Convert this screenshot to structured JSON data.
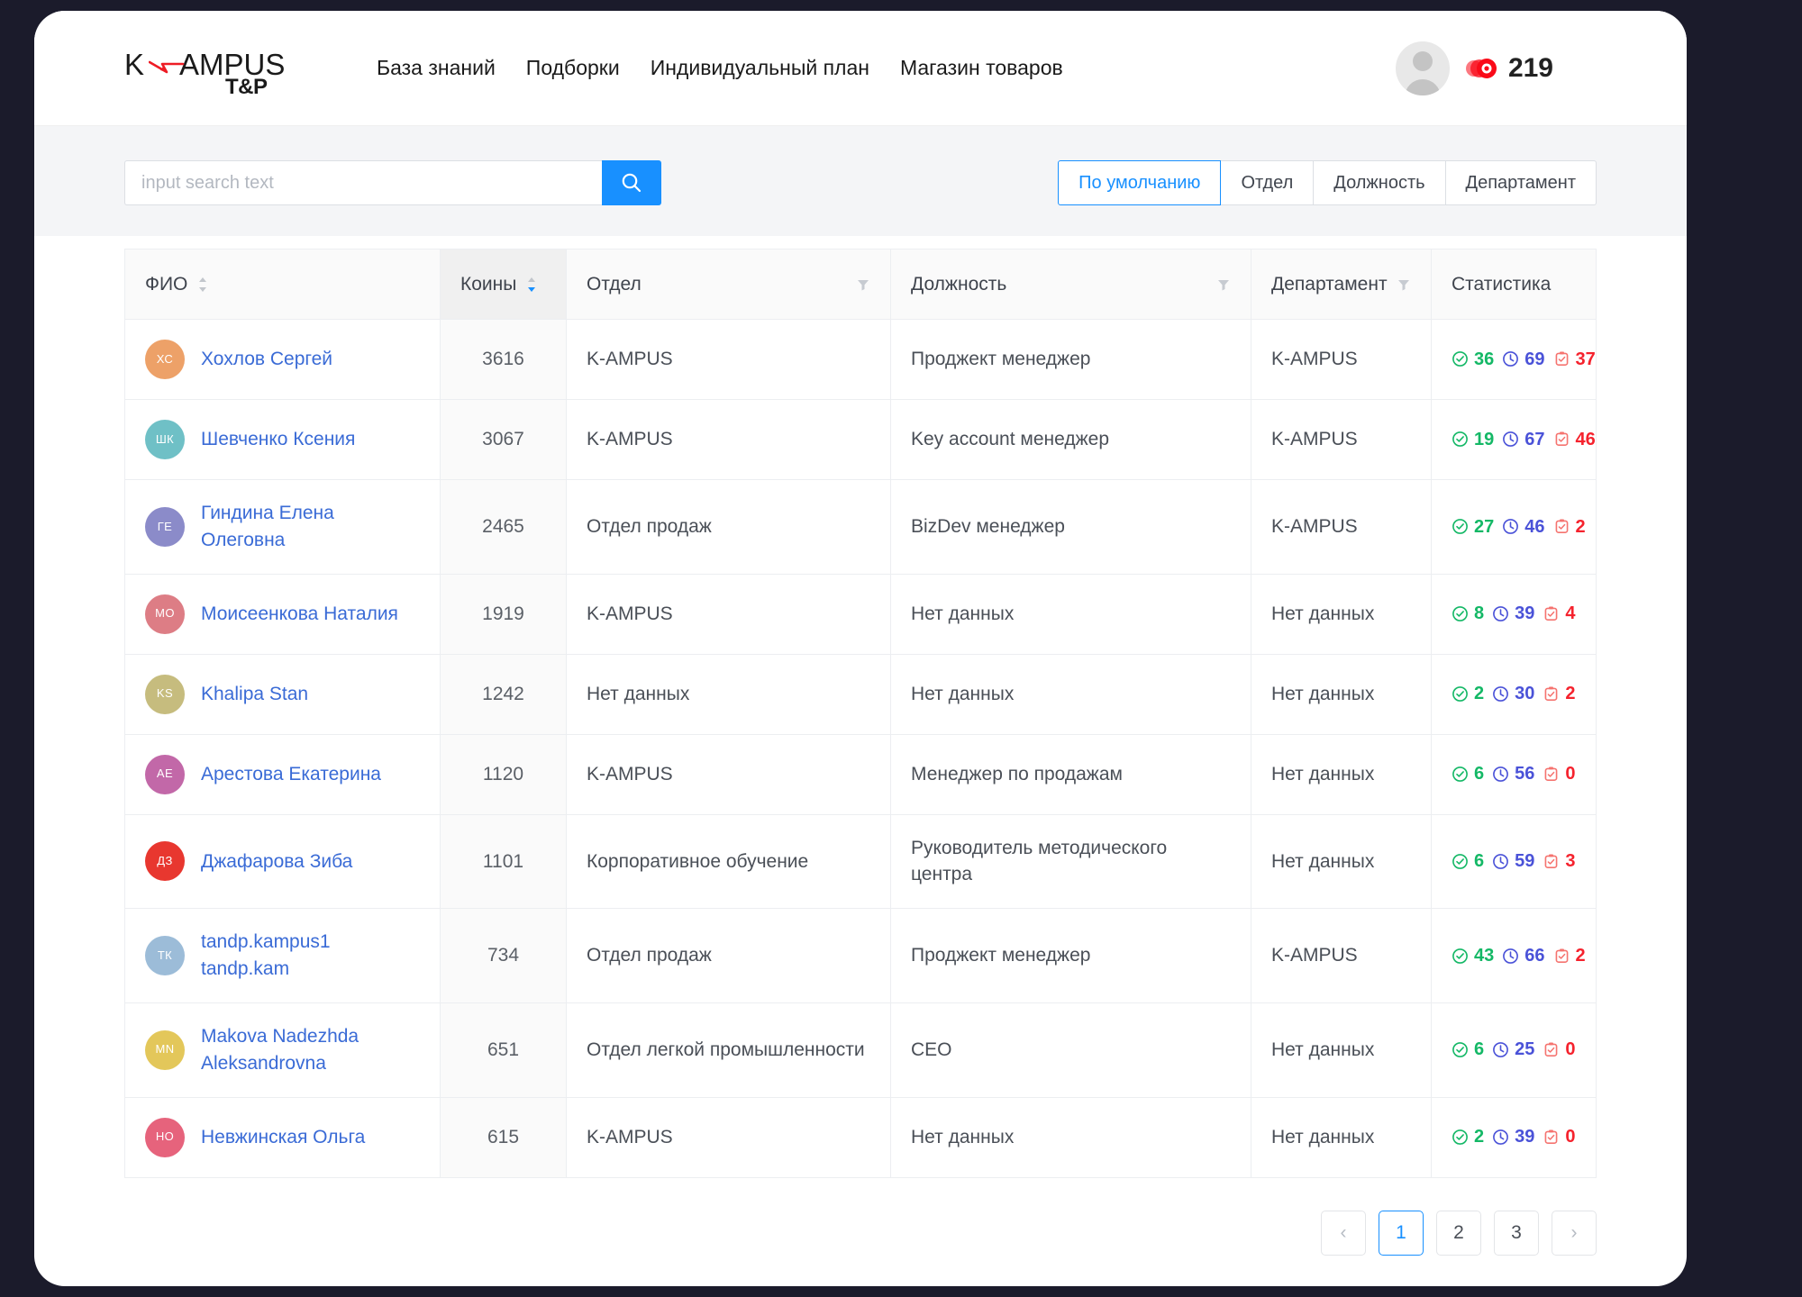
{
  "brand": {
    "logo_k": "K",
    "logo_ampus": "AMPUS",
    "logo_sub": "T&P"
  },
  "nav": {
    "items": [
      {
        "label": "База знаний"
      },
      {
        "label": "Подборки"
      },
      {
        "label": "Индивидуальный план"
      },
      {
        "label": "Магазин товаров"
      }
    ]
  },
  "header_right": {
    "coin_count": "219",
    "coin_color": "#fa0a18"
  },
  "search": {
    "placeholder": "input search text",
    "value": "",
    "icon": "search-icon"
  },
  "filters": {
    "items": [
      {
        "label": "По умолчанию",
        "active": true
      },
      {
        "label": "Отдел",
        "active": false
      },
      {
        "label": "Должность",
        "active": false
      },
      {
        "label": "Департамент",
        "active": false
      }
    ],
    "accent": "#1890ff"
  },
  "table": {
    "columns": [
      {
        "label": "ФИО",
        "sortable": true,
        "filterable": false,
        "sorted": false
      },
      {
        "label": "Коины",
        "sortable": true,
        "filterable": false,
        "sorted": true,
        "sort_dir": "desc"
      },
      {
        "label": "Отдел",
        "sortable": false,
        "filterable": true,
        "sorted": false
      },
      {
        "label": "Должность",
        "sortable": false,
        "filterable": true,
        "sorted": false
      },
      {
        "label": "Департамент",
        "sortable": false,
        "filterable": true,
        "sorted": false
      },
      {
        "label": "Статистика",
        "sortable": false,
        "filterable": false,
        "sorted": false
      }
    ],
    "rows": [
      {
        "initials": "ХС",
        "avatar_color": "#eda168",
        "name": "Хохлов Сергей",
        "coins": "3616",
        "otdel": "K-AMPUS",
        "dolzhnost": "Проджект менеджер",
        "departament": "K-AMPUS",
        "stats": {
          "done": "36",
          "time": "69",
          "task": "37"
        }
      },
      {
        "initials": "ШК",
        "avatar_color": "#6fc0c6",
        "name": "Шевченко Ксения",
        "coins": "3067",
        "otdel": "K-AMPUS",
        "dolzhnost": "Key account менеджер",
        "departament": "K-AMPUS",
        "stats": {
          "done": "19",
          "time": "67",
          "task": "46"
        }
      },
      {
        "initials": "ГЕ",
        "avatar_color": "#8b8bc9",
        "name": "Гиндина Елена Олеговна",
        "coins": "2465",
        "otdel": "Отдел продаж",
        "dolzhnost": "BizDev менеджер",
        "departament": "K-AMPUS",
        "stats": {
          "done": "27",
          "time": "46",
          "task": "2"
        }
      },
      {
        "initials": "МО",
        "avatar_color": "#dd7d85",
        "name": "Моисеенкова Наталия",
        "coins": "1919",
        "otdel": "K-AMPUS",
        "dolzhnost": "Нет данных",
        "departament": "Нет данных",
        "stats": {
          "done": "8",
          "time": "39",
          "task": "4"
        }
      },
      {
        "initials": "KS",
        "avatar_color": "#c6bc7e",
        "name": "Khalipa Stan",
        "coins": "1242",
        "otdel": "Нет данных",
        "dolzhnost": "Нет данных",
        "departament": "Нет данных",
        "stats": {
          "done": "2",
          "time": "30",
          "task": "2"
        }
      },
      {
        "initials": "АЕ",
        "avatar_color": "#c museum",
        "name": "Арестова Екатерина",
        "coins": "1120",
        "otdel": "K-AMPUS",
        "dolzhnost": "Менеджер по продажам",
        "departament": "Нет данных",
        "stats": {
          "done": "6",
          "time": "56",
          "task": "0"
        }
      },
      {
        "initials": "ДЗ",
        "avatar_color": "#e8372f",
        "name": "Джафарова Зиба",
        "coins": "1101",
        "otdel": "Корпоративное обучение",
        "dolzhnost": "Руководитель методического центра",
        "departament": "Нет данных",
        "stats": {
          "done": "6",
          "time": "59",
          "task": "3"
        }
      },
      {
        "initials": "ТК",
        "avatar_color": "#9cbcd8",
        "name": "tandp.kampus1 tandp.kam",
        "coins": "734",
        "otdel": "Отдел продаж",
        "dolzhnost": "Проджект менеджер",
        "departament": "K-AMPUS",
        "stats": {
          "done": "43",
          "time": "66",
          "task": "2"
        }
      },
      {
        "initials": "MN",
        "avatar_color": "#e3c75a",
        "name": "Makova Nadezhda Aleksandrovna",
        "coins": "651",
        "otdel": "Отдел легкой промышленности",
        "dolzhnost": "CEO",
        "departament": "Нет данных",
        "stats": {
          "done": "6",
          "time": "25",
          "task": "0"
        }
      },
      {
        "initials": "НО",
        "avatar_color": "#e6637c",
        "name": "Невжинская Ольга",
        "coins": "615",
        "otdel": "K-AMPUS",
        "dolzhnost": "Нет данных",
        "departament": "Нет данных",
        "stats": {
          "done": "2",
          "time": "39",
          "task": "0"
        }
      }
    ],
    "stat_colors": {
      "done": "#14b866",
      "time": "#4a52d8",
      "task": "#f5222d"
    }
  },
  "pagination": {
    "prev": "‹",
    "next": "›",
    "pages": [
      {
        "label": "1",
        "active": true
      },
      {
        "label": "2",
        "active": false
      },
      {
        "label": "3",
        "active": false
      }
    ]
  }
}
